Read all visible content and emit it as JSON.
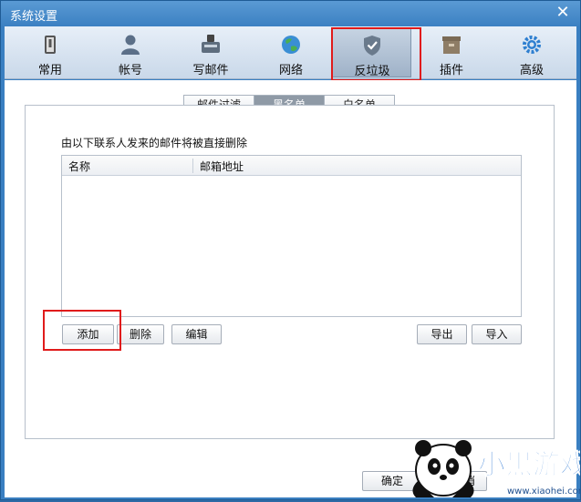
{
  "window": {
    "title": "系统设置",
    "close_glyph": "✕"
  },
  "toolbar": {
    "items": [
      {
        "label": "常用",
        "icon": "general-icon"
      },
      {
        "label": "帐号",
        "icon": "account-icon"
      },
      {
        "label": "写邮件",
        "icon": "compose-icon"
      },
      {
        "label": "网络",
        "icon": "network-icon"
      },
      {
        "label": "反垃圾",
        "icon": "shield-icon"
      },
      {
        "label": "插件",
        "icon": "plugin-icon"
      },
      {
        "label": "高级",
        "icon": "gear-icon"
      }
    ],
    "active_index": 4
  },
  "tabs": [
    {
      "label": "邮件过滤"
    },
    {
      "label": "黑名单"
    },
    {
      "label": "白名单"
    }
  ],
  "active_tab": 1,
  "description": "由以下联系人发来的邮件将被直接删除",
  "table": {
    "columns": [
      "名称",
      "邮箱地址"
    ],
    "rows": []
  },
  "buttons": {
    "add": "添加",
    "delete": "删除",
    "edit": "编辑",
    "export": "导出",
    "import": "导入"
  },
  "footer": {
    "ok": "确定",
    "cancel_partial": "消"
  },
  "watermark": {
    "brand": "小黑游戏",
    "url": "www.xiaohei.com"
  },
  "colors": {
    "titlebar": "#3b80c2",
    "highlight": "#e01b1b",
    "active_tab": "#8f9aa6"
  }
}
